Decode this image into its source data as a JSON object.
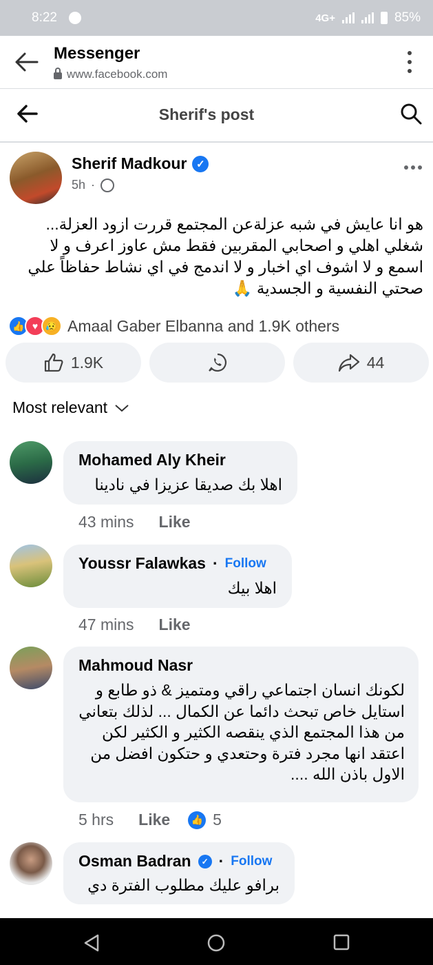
{
  "statusbar": {
    "time": "8:22",
    "network": "4G+",
    "battery": "85%"
  },
  "browser": {
    "title": "Messenger",
    "url": "www.facebook.com"
  },
  "header": {
    "title": "Sherif's post"
  },
  "post": {
    "author": "Sherif Madkour",
    "time": "5h",
    "dot": "·",
    "text": "هو انا عايش في شبه عزلةعن المجتمع قررت ازود العزلة... شغلي اهلي و اصحابي المقربين فقط مش عاوز اعرف و لا اسمع و لا اشوف اي اخبار و لا اندمج في اي نشاط حفاظاً علي صحتي النفسية و الجسدية 🙏",
    "reactions": "Amaal Gaber Elbanna and 1.9K others",
    "like_count": "1.9K",
    "share_count": "44"
  },
  "sort_label": "Most relevant",
  "comments": [
    {
      "name": "Mohamed Aly Kheir",
      "text": "اهلا بك صديقا عزيزا في نادينا",
      "time": "43 mins",
      "like": "Like"
    },
    {
      "name": "Youssr Falawkas",
      "dot": "·",
      "follow": "Follow",
      "text": "اهلا بيك",
      "time": "47 mins",
      "like": "Like"
    },
    {
      "name": "Mahmoud Nasr",
      "text": "لكونك انسان اجتماعي راقي ومتميز & ذو طابع و استايل خاص تبحث دائما عن الكمال ... لذلك بتعاني من هذا المجتمع الذي ينقصه الكثير و الكثير لكن اعتقد انها مجرد فترة وحتعدي و حتكون افضل من الاول باذن الله ....",
      "time": "5 hrs",
      "like": "Like",
      "reaction_count": "5"
    },
    {
      "name": "Osman Badran",
      "dot": "·",
      "follow": "Follow",
      "text": "برافو عليك مطلوب الفترة دي"
    }
  ],
  "colors": {
    "accent": "#1877f2",
    "bubble": "#f0f2f5",
    "muted": "#65676b"
  }
}
